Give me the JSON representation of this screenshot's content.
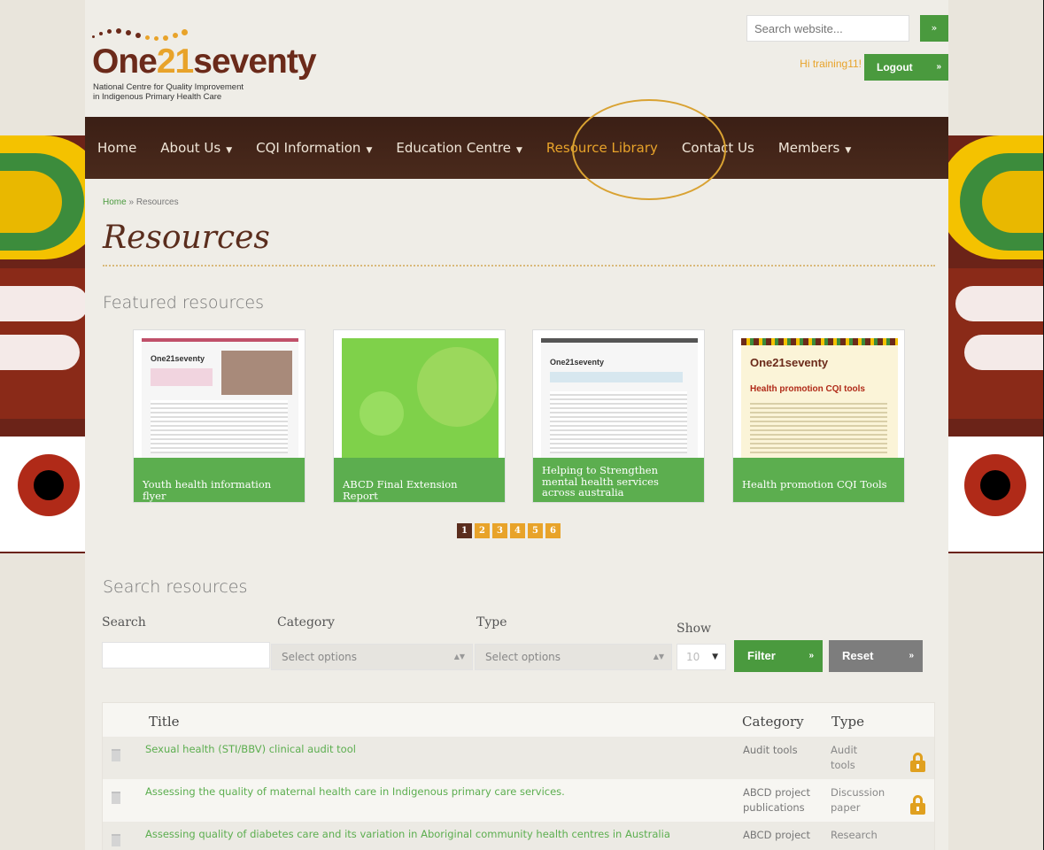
{
  "logo": {
    "part1": "One",
    "part2": "21",
    "part3": "seventy",
    "subtitle_line1": "National Centre for Quality Improvement",
    "subtitle_line2": "in Indigenous Primary Health Care"
  },
  "header": {
    "search_placeholder": "Search website...",
    "search_go": "»",
    "greeting": "Hi training11!",
    "logout": "Logout",
    "logout_arrow": "»"
  },
  "nav": {
    "items": [
      {
        "label": "Home"
      },
      {
        "label": "About Us",
        "caret": "▼"
      },
      {
        "label": "CQI Information",
        "caret": "▼"
      },
      {
        "label": "Education Centre",
        "caret": "▼"
      },
      {
        "label": "Resource Library"
      },
      {
        "label": "Contact Us"
      },
      {
        "label": "Members",
        "caret": "▼"
      }
    ],
    "active": "Resource Library"
  },
  "breadcrumb": {
    "home": "Home",
    "sep": " » ",
    "current": "Resources"
  },
  "page_title": "Resources",
  "featured": {
    "heading": "Featured resources",
    "cards": [
      {
        "caption": "Youth health information flyer"
      },
      {
        "caption": "ABCD Final Extension Report"
      },
      {
        "caption": "Helping to Strengthen mental health services across australia"
      },
      {
        "caption": "Health promotion CQI Tools"
      }
    ],
    "pages": [
      "1",
      "2",
      "3",
      "4",
      "5",
      "6"
    ],
    "current_page": "1"
  },
  "search": {
    "heading": "Search resources",
    "search_label": "Search",
    "category_label": "Category",
    "category_value": "Select options",
    "type_label": "Type",
    "type_value": "Select options",
    "show_label": "Show",
    "show_value": "10",
    "filter": "Filter",
    "reset": "Reset",
    "btn_arrow": "»"
  },
  "table": {
    "columns": [
      "Title",
      "Category",
      "Type"
    ],
    "rows": [
      {
        "title": "Sexual health (STI/BBV) clinical audit tool",
        "category": "Audit tools",
        "type": "Audit tools",
        "locked": true
      },
      {
        "title": "Assessing the quality of maternal health care in Indigenous primary care services.",
        "category": "ABCD project publications",
        "type": "Discussion paper",
        "locked": true
      },
      {
        "title": "Assessing quality of diabetes care and its variation in Aboriginal community health centres in Australia",
        "category": "ABCD project",
        "type": "Research",
        "locked": false
      }
    ]
  }
}
